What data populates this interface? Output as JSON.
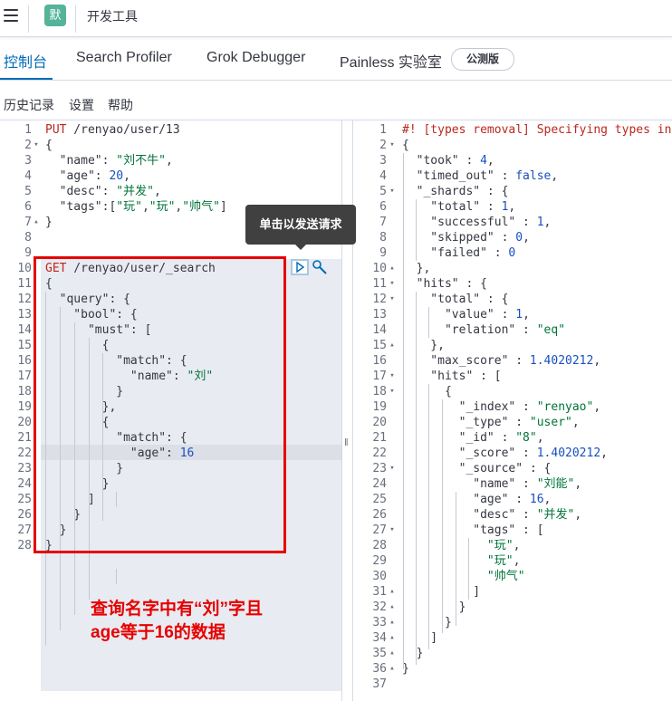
{
  "header": {
    "app_icon_letter": "默",
    "app_title": "开发工具"
  },
  "tabs": [
    {
      "label": "控制台",
      "active": true
    },
    {
      "label": "Search Profiler",
      "active": false
    },
    {
      "label": "Grok Debugger",
      "active": false
    },
    {
      "label": "Painless 实验室",
      "active": false
    }
  ],
  "beta_badge": "公测版",
  "subnav": [
    "历史记录",
    "设置",
    "帮助"
  ],
  "tooltip": "单击以发送请求",
  "annotation": [
    "查询名字中有“刘”字且",
    "age等于16的数据"
  ],
  "request_lines": [
    {
      "n": 1,
      "fold": "",
      "html": [
        [
          "m",
          "PUT"
        ],
        [
          "k",
          " /renyao/user/13"
        ]
      ]
    },
    {
      "n": 2,
      "fold": "v",
      "html": [
        [
          "k",
          "{"
        ]
      ]
    },
    {
      "n": 3,
      "fold": "",
      "html": [
        [
          "k",
          "  \"name\": "
        ],
        [
          "s",
          "\"刘不牛\""
        ],
        [
          "k",
          ","
        ]
      ]
    },
    {
      "n": 4,
      "fold": "",
      "html": [
        [
          "k",
          "  \"age\": "
        ],
        [
          "n",
          "20"
        ],
        [
          "k",
          ","
        ]
      ]
    },
    {
      "n": 5,
      "fold": "",
      "html": [
        [
          "k",
          "  \"desc\": "
        ],
        [
          "s",
          "\"并发\""
        ],
        [
          "k",
          ","
        ]
      ]
    },
    {
      "n": 6,
      "fold": "",
      "html": [
        [
          "k",
          "  \"tags\":["
        ],
        [
          "s",
          "\"玩\""
        ],
        [
          "k",
          ","
        ],
        [
          "s",
          "\"玩\""
        ],
        [
          "k",
          ","
        ],
        [
          "s",
          "\"帅气\""
        ],
        [
          "k",
          "]"
        ]
      ]
    },
    {
      "n": 7,
      "fold": "^",
      "html": [
        [
          "k",
          "}"
        ]
      ]
    },
    {
      "n": 8,
      "fold": "",
      "html": []
    },
    {
      "n": 9,
      "fold": "",
      "html": []
    },
    {
      "n": 10,
      "fold": "",
      "html": [
        [
          "m",
          "GET"
        ],
        [
          "k",
          " /renyao/user/_search"
        ]
      ]
    },
    {
      "n": 11,
      "fold": "",
      "html": [
        [
          "k",
          "{"
        ]
      ]
    },
    {
      "n": 12,
      "fold": "",
      "html": [
        [
          "k",
          "  \"query\": {"
        ]
      ]
    },
    {
      "n": 13,
      "fold": "",
      "html": [
        [
          "k",
          "    \"bool\": {"
        ]
      ]
    },
    {
      "n": 14,
      "fold": "",
      "html": [
        [
          "k",
          "      \"must\": ["
        ]
      ]
    },
    {
      "n": 15,
      "fold": "",
      "html": [
        [
          "k",
          "        {"
        ]
      ]
    },
    {
      "n": 16,
      "fold": "",
      "html": [
        [
          "k",
          "          \"match\": {"
        ]
      ]
    },
    {
      "n": 17,
      "fold": "",
      "html": [
        [
          "k",
          "            \"name\": "
        ],
        [
          "s",
          "\"刘\""
        ]
      ]
    },
    {
      "n": 18,
      "fold": "",
      "html": [
        [
          "k",
          "          }"
        ]
      ]
    },
    {
      "n": 19,
      "fold": "",
      "html": [
        [
          "k",
          "        },"
        ]
      ]
    },
    {
      "n": 20,
      "fold": "",
      "html": [
        [
          "k",
          "        {"
        ]
      ]
    },
    {
      "n": 21,
      "fold": "",
      "html": [
        [
          "k",
          "          \"match\": {"
        ]
      ]
    },
    {
      "n": 22,
      "fold": "",
      "html": [
        [
          "k",
          "            \"age\": "
        ],
        [
          "n",
          "16"
        ]
      ]
    },
    {
      "n": 23,
      "fold": "",
      "html": [
        [
          "k",
          "          }"
        ]
      ]
    },
    {
      "n": 24,
      "fold": "",
      "html": [
        [
          "k",
          "        }"
        ]
      ]
    },
    {
      "n": 25,
      "fold": "",
      "html": [
        [
          "k",
          "      ]"
        ]
      ]
    },
    {
      "n": 26,
      "fold": "",
      "html": [
        [
          "k",
          "    }"
        ]
      ]
    },
    {
      "n": 27,
      "fold": "",
      "html": [
        [
          "k",
          "  }"
        ]
      ]
    },
    {
      "n": 28,
      "fold": "",
      "html": [
        [
          "k",
          "}"
        ]
      ]
    }
  ],
  "response_lines": [
    {
      "n": 1,
      "fold": "",
      "html": [
        [
          "c",
          "#! [types removal] Specifying types in"
        ]
      ]
    },
    {
      "n": 2,
      "fold": "v",
      "html": [
        [
          "k",
          "{"
        ]
      ]
    },
    {
      "n": 3,
      "fold": "",
      "html": [
        [
          "k",
          "  \"took\" : "
        ],
        [
          "n",
          "4"
        ],
        [
          "k",
          ","
        ]
      ]
    },
    {
      "n": 4,
      "fold": "",
      "html": [
        [
          "k",
          "  \"timed_out\" : "
        ],
        [
          "n",
          "false"
        ],
        [
          "k",
          ","
        ]
      ]
    },
    {
      "n": 5,
      "fold": "v",
      "html": [
        [
          "k",
          "  \"_shards\" : {"
        ]
      ]
    },
    {
      "n": 6,
      "fold": "",
      "html": [
        [
          "k",
          "    \"total\" : "
        ],
        [
          "n",
          "1"
        ],
        [
          "k",
          ","
        ]
      ]
    },
    {
      "n": 7,
      "fold": "",
      "html": [
        [
          "k",
          "    \"successful\" : "
        ],
        [
          "n",
          "1"
        ],
        [
          "k",
          ","
        ]
      ]
    },
    {
      "n": 8,
      "fold": "",
      "html": [
        [
          "k",
          "    \"skipped\" : "
        ],
        [
          "n",
          "0"
        ],
        [
          "k",
          ","
        ]
      ]
    },
    {
      "n": 9,
      "fold": "",
      "html": [
        [
          "k",
          "    \"failed\" : "
        ],
        [
          "n",
          "0"
        ]
      ]
    },
    {
      "n": 10,
      "fold": "^",
      "html": [
        [
          "k",
          "  },"
        ]
      ]
    },
    {
      "n": 11,
      "fold": "v",
      "html": [
        [
          "k",
          "  \"hits\" : {"
        ]
      ]
    },
    {
      "n": 12,
      "fold": "v",
      "html": [
        [
          "k",
          "    \"total\" : {"
        ]
      ]
    },
    {
      "n": 13,
      "fold": "",
      "html": [
        [
          "k",
          "      \"value\" : "
        ],
        [
          "n",
          "1"
        ],
        [
          "k",
          ","
        ]
      ]
    },
    {
      "n": 14,
      "fold": "",
      "html": [
        [
          "k",
          "      \"relation\" : "
        ],
        [
          "s",
          "\"eq\""
        ]
      ]
    },
    {
      "n": 15,
      "fold": "^",
      "html": [
        [
          "k",
          "    },"
        ]
      ]
    },
    {
      "n": 16,
      "fold": "",
      "html": [
        [
          "k",
          "    \"max_score\" : "
        ],
        [
          "n",
          "1.4020212"
        ],
        [
          "k",
          ","
        ]
      ]
    },
    {
      "n": 17,
      "fold": "v",
      "html": [
        [
          "k",
          "    \"hits\" : ["
        ]
      ]
    },
    {
      "n": 18,
      "fold": "v",
      "html": [
        [
          "k",
          "      {"
        ]
      ]
    },
    {
      "n": 19,
      "fold": "",
      "html": [
        [
          "k",
          "        \"_index\" : "
        ],
        [
          "s",
          "\"renyao\""
        ],
        [
          "k",
          ","
        ]
      ]
    },
    {
      "n": 20,
      "fold": "",
      "html": [
        [
          "k",
          "        \"_type\" : "
        ],
        [
          "s",
          "\"user\""
        ],
        [
          "k",
          ","
        ]
      ]
    },
    {
      "n": 21,
      "fold": "",
      "html": [
        [
          "k",
          "        \"_id\" : "
        ],
        [
          "s",
          "\"8\""
        ],
        [
          "k",
          ","
        ]
      ]
    },
    {
      "n": 22,
      "fold": "",
      "html": [
        [
          "k",
          "        \"_score\" : "
        ],
        [
          "n",
          "1.4020212"
        ],
        [
          "k",
          ","
        ]
      ]
    },
    {
      "n": 23,
      "fold": "v",
      "html": [
        [
          "k",
          "        \"_source\" : {"
        ]
      ]
    },
    {
      "n": 24,
      "fold": "",
      "html": [
        [
          "k",
          "          \"name\" : "
        ],
        [
          "s",
          "\"刘能\""
        ],
        [
          "k",
          ","
        ]
      ]
    },
    {
      "n": 25,
      "fold": "",
      "html": [
        [
          "k",
          "          \"age\" : "
        ],
        [
          "n",
          "16"
        ],
        [
          "k",
          ","
        ]
      ]
    },
    {
      "n": 26,
      "fold": "",
      "html": [
        [
          "k",
          "          \"desc\" : "
        ],
        [
          "s",
          "\"并发\""
        ],
        [
          "k",
          ","
        ]
      ]
    },
    {
      "n": 27,
      "fold": "v",
      "html": [
        [
          "k",
          "          \"tags\" : ["
        ]
      ]
    },
    {
      "n": 28,
      "fold": "",
      "html": [
        [
          "s",
          "            \"玩\""
        ],
        [
          "k",
          ","
        ]
      ]
    },
    {
      "n": 29,
      "fold": "",
      "html": [
        [
          "s",
          "            \"玩\""
        ],
        [
          "k",
          ","
        ]
      ]
    },
    {
      "n": 30,
      "fold": "",
      "html": [
        [
          "s",
          "            \"帅气\""
        ]
      ]
    },
    {
      "n": 31,
      "fold": "^",
      "html": [
        [
          "k",
          "          ]"
        ]
      ]
    },
    {
      "n": 32,
      "fold": "^",
      "html": [
        [
          "k",
          "        }"
        ]
      ]
    },
    {
      "n": 33,
      "fold": "^",
      "html": [
        [
          "k",
          "      }"
        ]
      ]
    },
    {
      "n": 34,
      "fold": "^",
      "html": [
        [
          "k",
          "    ]"
        ]
      ]
    },
    {
      "n": 35,
      "fold": "^",
      "html": [
        [
          "k",
          "  }"
        ]
      ]
    },
    {
      "n": 36,
      "fold": "^",
      "html": [
        [
          "k",
          "}"
        ]
      ]
    },
    {
      "n": 37,
      "fold": "",
      "html": []
    }
  ]
}
